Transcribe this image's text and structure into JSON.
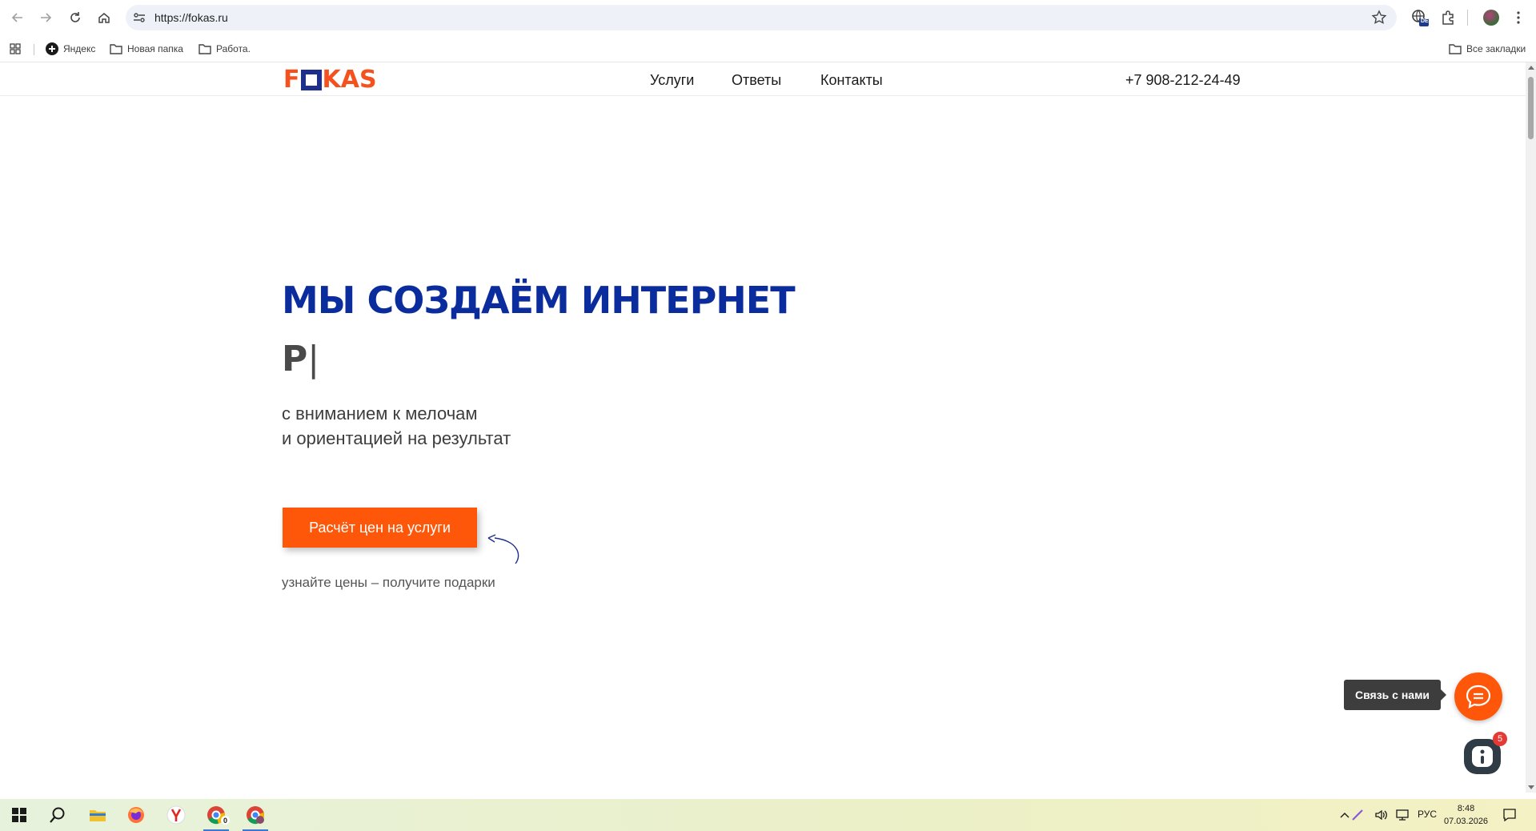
{
  "browser": {
    "url": "https://fokas.ru",
    "bookmarks": [
      {
        "label": "Яндекс",
        "icon": "yandex-icon"
      },
      {
        "label": "Новая папка",
        "icon": "folder-icon"
      },
      {
        "label": "Работа.",
        "icon": "folder-icon"
      }
    ],
    "all_bookmarks_label": "Все закладки",
    "extension_badge": "DE"
  },
  "site": {
    "logo": {
      "left": "F",
      "right": "KAS"
    },
    "menu": [
      "Услуги",
      "Ответы",
      "Контакты"
    ],
    "phone": "+7 908-212-24-49",
    "hero": {
      "title": "МЫ СОЗДАЁМ ИНТЕРНЕТ",
      "typed": "Р",
      "caret": "|",
      "subtitle_line1": "с вниманием к мелочам",
      "subtitle_line2": "и ориентацией на результат",
      "cta_label": "Расчёт цен на услуги",
      "cta_note": "узнайте цены – получите подарки"
    },
    "contact_tooltip": "Связь с нами",
    "messenger_badge": "5",
    "colors": {
      "brand_orange": "#ff5709",
      "brand_blue": "#0a2c9c"
    }
  },
  "taskbar": {
    "language": "РУС",
    "time": "8:48",
    "date": "07.03.2026",
    "chrome_badge": "0"
  }
}
